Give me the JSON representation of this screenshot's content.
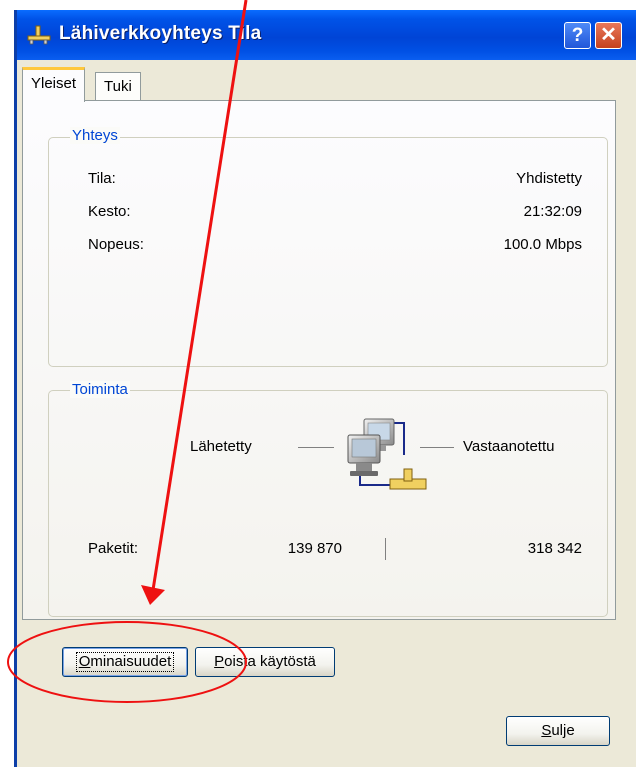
{
  "window": {
    "title": "Lähiverkkoyhteys Tila",
    "help_label": "?",
    "close_label": "✕",
    "icon": "network-connection-icon"
  },
  "tabs": [
    {
      "label": "Yleiset",
      "active": true
    },
    {
      "label": "Tuki",
      "active": false
    }
  ],
  "connection": {
    "heading": "Yhteys",
    "rows": [
      {
        "label": "Tila:",
        "value": "Yhdistetty"
      },
      {
        "label": "Kesto:",
        "value": "21:32:09"
      },
      {
        "label": "Nopeus:",
        "value": "100.0 Mbps"
      }
    ]
  },
  "activity": {
    "heading": "Toiminta",
    "sent_label": "Lähetetty",
    "received_label": "Vastaanotettu",
    "packets_label": "Paketit:",
    "packets_sent": "139 870",
    "packets_received": "318 342",
    "icon": "network-computers-icon"
  },
  "buttons": {
    "properties": {
      "mnemonic": "O",
      "rest": "minaisuudet"
    },
    "disable": {
      "mnemonic": "P",
      "rest": "oista käytöstä"
    },
    "close": {
      "mnemonic": "S",
      "rest": "ulje"
    }
  },
  "colors": {
    "titlebar": "#0054e3",
    "group_heading": "#0046d5",
    "annotation": "#ee1111",
    "active_tab_accent": "#ffc83c"
  }
}
